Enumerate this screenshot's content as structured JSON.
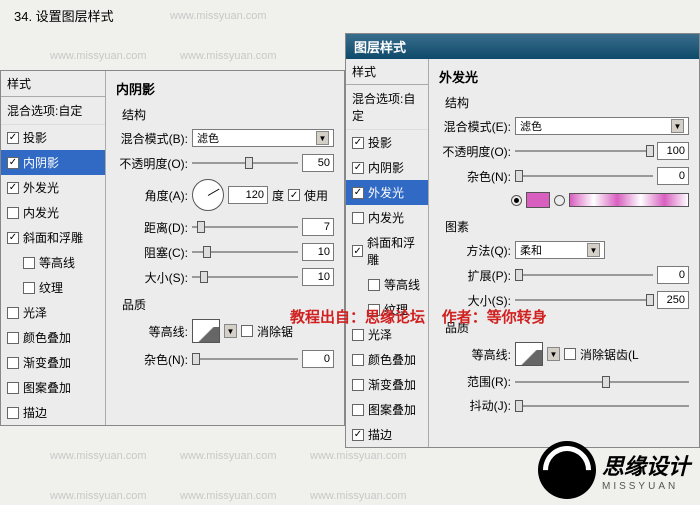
{
  "step_title": "34. 设置图层样式",
  "watermark_text": "www.missyuan.com",
  "credit_line1": "教程出自：思缘论坛",
  "credit_line2": "作者：等你转身",
  "logo_text": "思缘设计",
  "logo_sub": "MISSYUAN",
  "dialog_left": {
    "title_header": "样式",
    "blend_options": "混合选项:自定",
    "styles": [
      {
        "label": "投影",
        "checked": true,
        "selected": false
      },
      {
        "label": "内阴影",
        "checked": true,
        "selected": true
      },
      {
        "label": "外发光",
        "checked": true,
        "selected": false
      },
      {
        "label": "内发光",
        "checked": false,
        "selected": false
      },
      {
        "label": "斜面和浮雕",
        "checked": true,
        "selected": false
      },
      {
        "label": "等高线",
        "checked": false,
        "selected": false,
        "indent": true
      },
      {
        "label": "纹理",
        "checked": false,
        "selected": false,
        "indent": true
      },
      {
        "label": "光泽",
        "checked": false,
        "selected": false
      },
      {
        "label": "颜色叠加",
        "checked": false,
        "selected": false
      },
      {
        "label": "渐变叠加",
        "checked": false,
        "selected": false
      },
      {
        "label": "图案叠加",
        "checked": false,
        "selected": false
      },
      {
        "label": "描边",
        "checked": false,
        "selected": false
      }
    ],
    "panel_title": "内阴影",
    "structure_label": "结构",
    "blend_mode_label": "混合模式(B):",
    "blend_mode_value": "滤色",
    "opacity_label": "不透明度(O):",
    "opacity_value": "50",
    "angle_label": "角度(A):",
    "angle_value": "120",
    "angle_unit": "度",
    "use_global": "使用",
    "distance_label": "距离(D):",
    "distance_value": "7",
    "choke_label": "阻塞(C):",
    "choke_value": "10",
    "size_label": "大小(S):",
    "size_value": "10",
    "quality_label": "品质",
    "contour_label": "等高线:",
    "antialias": "消除锯",
    "noise_label": "杂色(N):",
    "noise_value": "0"
  },
  "dialog_right": {
    "titlebar": "图层样式",
    "title_header": "样式",
    "blend_options": "混合选项:自定",
    "styles": [
      {
        "label": "投影",
        "checked": true,
        "selected": false
      },
      {
        "label": "内阴影",
        "checked": true,
        "selected": false
      },
      {
        "label": "外发光",
        "checked": true,
        "selected": true
      },
      {
        "label": "内发光",
        "checked": false,
        "selected": false
      },
      {
        "label": "斜面和浮雕",
        "checked": true,
        "selected": false
      },
      {
        "label": "等高线",
        "checked": false,
        "selected": false,
        "indent": true
      },
      {
        "label": "纹理",
        "checked": false,
        "selected": false,
        "indent": true
      },
      {
        "label": "光泽",
        "checked": false,
        "selected": false
      },
      {
        "label": "颜色叠加",
        "checked": false,
        "selected": false
      },
      {
        "label": "渐变叠加",
        "checked": false,
        "selected": false
      },
      {
        "label": "图案叠加",
        "checked": false,
        "selected": false
      },
      {
        "label": "描边",
        "checked": true,
        "selected": false
      }
    ],
    "panel_title": "外发光",
    "structure_label": "结构",
    "blend_mode_label": "混合模式(E):",
    "blend_mode_value": "滤色",
    "opacity_label": "不透明度(O):",
    "opacity_value": "100",
    "noise_label": "杂色(N):",
    "noise_value": "0",
    "color_hex": "#d85fc0",
    "elements_label": "图素",
    "technique_label": "方法(Q):",
    "technique_value": "柔和",
    "spread_label": "扩展(P):",
    "spread_value": "0",
    "size_label": "大小(S):",
    "size_value": "250",
    "quality_label": "品质",
    "contour_label": "等高线:",
    "antialias": "消除锯齿(L",
    "range_label": "范围(R):",
    "jitter_label": "抖动(J):"
  }
}
